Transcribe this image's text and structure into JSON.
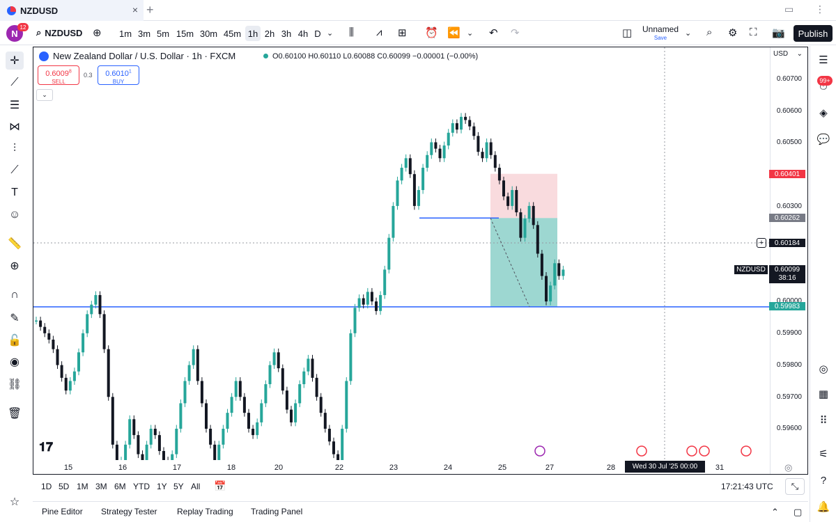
{
  "tab": {
    "title": "NZDUSD",
    "close": "×",
    "new": "+"
  },
  "toolbar": {
    "avatar_letter": "N",
    "avatar_badge": "12",
    "symbol": "NZDUSD",
    "intervals": [
      "1m",
      "3m",
      "5m",
      "15m",
      "30m",
      "45m",
      "1h",
      "2h",
      "3h",
      "4h",
      "D"
    ],
    "active_interval": "1h",
    "layout_name": "Unnamed",
    "save_label": "Save",
    "publish_label": "Publish"
  },
  "legend": {
    "title": "New Zealand Dollar / U.S. Dollar · 1h · FXCM",
    "ohlc": "O0.60100 H0.60110 L0.60088 C0.60099 −0.00001 (−0.00%)"
  },
  "trade": {
    "sell_price": "0.6009",
    "sell_sup": "8",
    "sell_label": "SELL",
    "spread": "0.3",
    "buy_price": "0.6010",
    "buy_sup": "1",
    "buy_label": "BUY"
  },
  "price_scale": {
    "currency": "USD",
    "labels": [
      "0.60700",
      "0.60600",
      "0.60500",
      "0.60300",
      "0.60000",
      "0.59900",
      "0.59800",
      "0.59700",
      "0.59600"
    ],
    "stop_tag": "0.60401",
    "entry_tag": "0.60262",
    "cursor_tag": "0.60184",
    "last_tag": "0.60099",
    "last_countdown": "38:16",
    "target_tag": "0.59983",
    "symbol_tag": "NZDUSD"
  },
  "time_scale": {
    "labels": [
      "15",
      "16",
      "17",
      "18",
      "20",
      "22",
      "23",
      "24",
      "25",
      "27",
      "28",
      "31"
    ],
    "cursor_time": "Wed 30 Jul '25   00:00"
  },
  "range_bar": {
    "ranges": [
      "1D",
      "5D",
      "1M",
      "3M",
      "6M",
      "YTD",
      "1Y",
      "5Y",
      "All"
    ],
    "clock": "17:21:43 UTC"
  },
  "bottom_tabs": [
    "Pine Editor",
    "Strategy Tester",
    "Replay Trading",
    "Trading Panel"
  ],
  "right_badge": "99+",
  "colors": {
    "up": "#26a69a",
    "down": "#131722",
    "stop_zone": "#f8d7da",
    "target_zone": "#26a69a",
    "level_line": "#2962ff"
  }
}
